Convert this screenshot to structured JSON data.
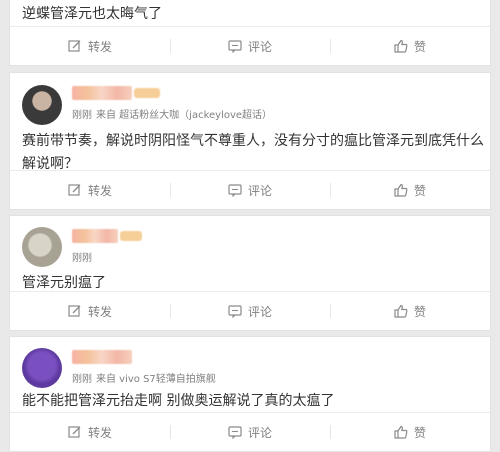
{
  "top_card": {
    "text": "逆蝶管泽元也太晦气了",
    "actions": {
      "repost": "转发",
      "comment": "评论",
      "like": "赞"
    }
  },
  "comments": [
    {
      "meta_time": "刚刚",
      "meta_source": "来自 超话粉丝大咖（jackeylove超话）",
      "text_line1": "赛前带节奏，解说时阴阳怪气不尊重人，没有分寸的瘟比管泽元到底凭什么",
      "text_line2": "解说啊？",
      "actions": {
        "repost": "转发",
        "comment": "评论",
        "like": "赞"
      }
    },
    {
      "meta_time": "刚刚",
      "text": "管泽元别瘟了",
      "actions": {
        "repost": "转发",
        "comment": "评论",
        "like": "赞"
      }
    },
    {
      "meta_time": "刚刚",
      "meta_source": "来自 vivo S7轻薄自拍旗舰",
      "text": "能不能把管泽元抬走啊 别做奥运解说了真的太瘟了",
      "actions": {
        "repost": "转发",
        "comment": "评论",
        "like": "赞"
      }
    }
  ],
  "icons": {
    "repost": "edit-share-icon",
    "comment": "comment-bubble-icon",
    "like": "thumbs-up-icon"
  },
  "colors": {
    "background": "#e9e9e9",
    "card": "#ffffff",
    "muted_text": "#808080",
    "body_text": "#333333"
  }
}
